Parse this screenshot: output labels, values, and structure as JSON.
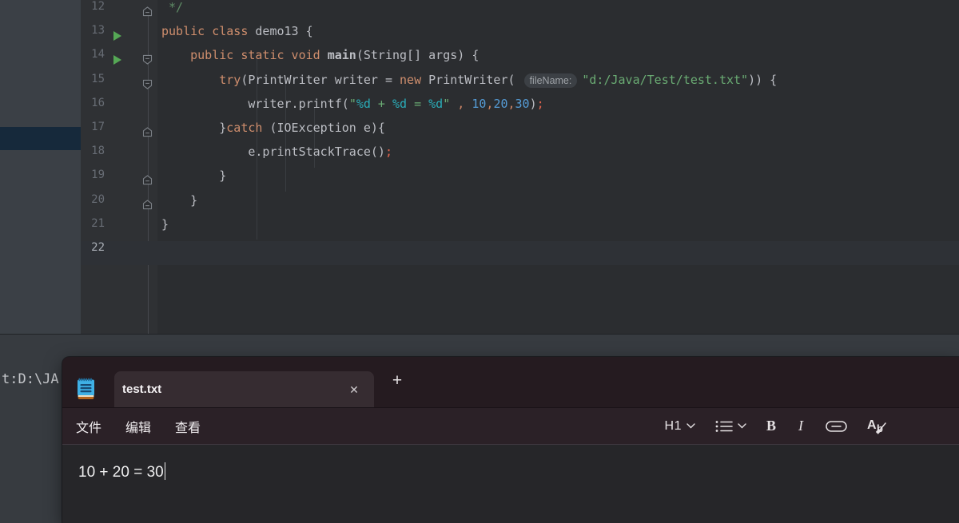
{
  "ide": {
    "editor": {
      "active_line": 22,
      "lines": [
        {
          "num": 12,
          "run": false,
          "fold": "up",
          "tokens": [
            [
              "cm",
              " */"
            ]
          ]
        },
        {
          "num": 13,
          "run": true,
          "fold": null,
          "tokens": [
            [
              "kw",
              "public class"
            ],
            [
              "pl",
              " demo13 {"
            ]
          ]
        },
        {
          "num": 14,
          "run": true,
          "fold": "down",
          "tokens": [
            [
              "pl",
              "    "
            ],
            [
              "kw",
              "public static void"
            ],
            [
              "pl",
              " "
            ],
            [
              "md",
              "main"
            ],
            [
              "pl",
              "(String[] args) {"
            ]
          ]
        },
        {
          "num": 15,
          "run": false,
          "fold": "down",
          "tokens": [
            [
              "pl",
              "        "
            ],
            [
              "kw",
              "try"
            ],
            [
              "pl",
              "(PrintWriter writer = "
            ],
            [
              "kw",
              "new"
            ],
            [
              "pl",
              " PrintWriter( "
            ],
            [
              "hint",
              "fileName:"
            ],
            [
              "str",
              "\"d:/Java/Test/test.txt\""
            ],
            [
              "pl",
              ")) {"
            ]
          ]
        },
        {
          "num": 16,
          "run": false,
          "fold": null,
          "tokens": [
            [
              "pl",
              "            writer.printf("
            ],
            [
              "str",
              "\""
            ],
            [
              "fmt",
              "%d"
            ],
            [
              "str",
              " + "
            ],
            [
              "fmt",
              "%d"
            ],
            [
              "str",
              " = "
            ],
            [
              "fmt",
              "%d"
            ],
            [
              "str",
              "\""
            ],
            [
              "pl",
              " "
            ],
            [
              "sep",
              ","
            ],
            [
              "pl",
              " "
            ],
            [
              "num",
              "10"
            ],
            [
              "sep",
              ","
            ],
            [
              "num",
              "20"
            ],
            [
              "sep",
              ","
            ],
            [
              "num",
              "30"
            ],
            [
              "pl",
              ")"
            ],
            [
              "semi",
              ";"
            ]
          ]
        },
        {
          "num": 17,
          "run": false,
          "fold": "up",
          "tokens": [
            [
              "pl",
              "        }"
            ],
            [
              "kw",
              "catch"
            ],
            [
              "pl",
              " (IOException e){"
            ]
          ]
        },
        {
          "num": 18,
          "run": false,
          "fold": null,
          "tokens": [
            [
              "pl",
              "            e.printStackTrace()"
            ],
            [
              "semi",
              ";"
            ]
          ]
        },
        {
          "num": 19,
          "run": false,
          "fold": "up",
          "tokens": [
            [
              "pl",
              "        }"
            ]
          ]
        },
        {
          "num": 20,
          "run": false,
          "fold": "up",
          "tokens": [
            [
              "pl",
              "    }"
            ]
          ]
        },
        {
          "num": 21,
          "run": false,
          "fold": null,
          "tokens": [
            [
              "pl",
              "}"
            ]
          ]
        },
        {
          "num": 22,
          "run": false,
          "fold": null,
          "tokens": []
        }
      ]
    },
    "console_text": "t:D:\\JA"
  },
  "notepad": {
    "tab": {
      "title": "test.txt",
      "close_glyph": "✕"
    },
    "new_tab_glyph": "+",
    "menus": [
      {
        "label": "文件"
      },
      {
        "label": "编辑"
      },
      {
        "label": "查看"
      }
    ],
    "toolbar": {
      "heading_label": "H1",
      "bold_label": "B",
      "italic_label": "I",
      "clear_a": "A",
      "clear_b": "b"
    },
    "content": {
      "text": "10 + 20 = 30"
    }
  },
  "colors": {
    "keyword": "#CF8E6D",
    "string": "#6AAB73",
    "number": "#559CD6",
    "format_spec": "#2AACB8",
    "comment": "#5F8C66",
    "run_arrow_green": "#55A855",
    "selection_blue": "#16293B",
    "editor_bg": "#2b2d30",
    "panel_bg": "#3b4046",
    "notepad_titlebar": "#251B20",
    "notepad_tab": "#362C31",
    "notepad_menubar": "#2B2127",
    "notepad_content": "#262629",
    "notepad_icon_blue": "#3FB0E5"
  }
}
